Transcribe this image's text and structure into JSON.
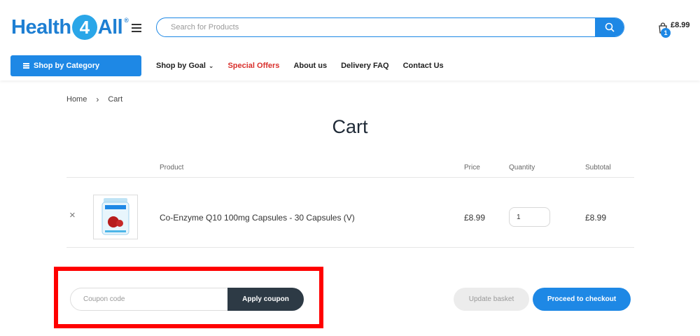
{
  "header": {
    "logo": {
      "part1": "Health",
      "part2": "4",
      "part3": "All",
      "reg": "®"
    },
    "search_placeholder": "Search for Products",
    "cart": {
      "count": "1",
      "total": "£8.99"
    }
  },
  "nav": {
    "shop_by_category": "Shop by Category",
    "links": [
      "Shop by Goal",
      "Special Offers",
      "About us",
      "Delivery FAQ",
      "Contact Us"
    ]
  },
  "breadcrumb": {
    "home": "Home",
    "current": "Cart"
  },
  "page_title": "Cart",
  "table": {
    "headers": {
      "product": "Product",
      "price": "Price",
      "quantity": "Quantity",
      "subtotal": "Subtotal"
    },
    "rows": [
      {
        "name": "Co-Enzyme Q10 100mg Capsules - 30 Capsules (V)",
        "price": "£8.99",
        "quantity": "1",
        "subtotal": "£8.99"
      }
    ]
  },
  "actions": {
    "coupon_placeholder": "Coupon code",
    "apply_coupon": "Apply coupon",
    "update_basket": "Update basket",
    "checkout": "Proceed to checkout"
  },
  "colors": {
    "brand_blue": "#1e88e5",
    "special": "#d9302c",
    "dark_button": "#2d3a45",
    "highlight": "#ff0000"
  }
}
